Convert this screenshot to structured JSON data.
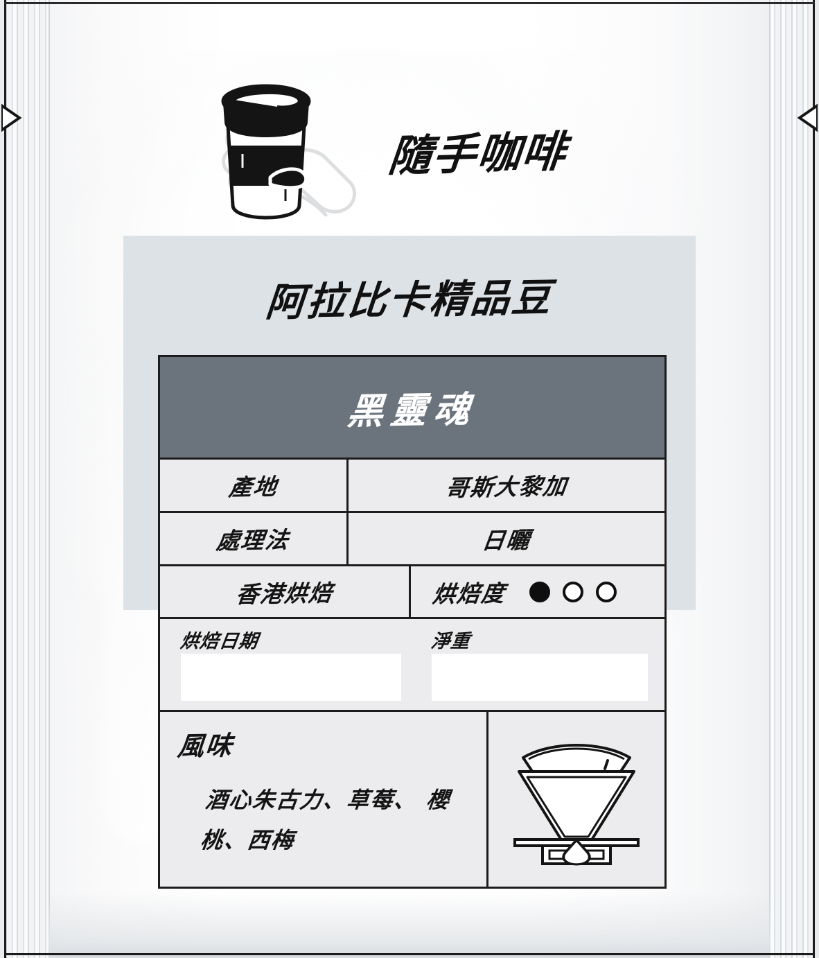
{
  "brand": {
    "name": "隨手咖啡",
    "logo_icon": "reusable-coffee-cup-in-hand-icon"
  },
  "label": {
    "subtitle": "阿拉比卡精品豆",
    "product_name": "黑靈魂"
  },
  "spec_table": {
    "rows": [
      {
        "label": "產地",
        "value": "哥斯大黎加"
      },
      {
        "label": "處理法",
        "value": "日曬"
      }
    ],
    "roast_row": {
      "origin_label": "香港烘焙",
      "roast_level_label": "烘焙度",
      "levels_total": 3,
      "levels_filled": 1
    },
    "write_in": {
      "roast_date_label": "烘焙日期",
      "roast_date_value": "",
      "net_weight_label": "淨重",
      "net_weight_value": ""
    },
    "flavour": {
      "title": "風味",
      "notes": "酒心朱古力、草莓、\n櫻桃、西梅"
    },
    "brew_icon": "pour-over-dripper-icon"
  },
  "colors": {
    "header_bar": "#6b747d",
    "label_panel": "#dde2e7",
    "table_cell": "#ececee",
    "ink": "#141414",
    "write_box": "#ffffff"
  }
}
